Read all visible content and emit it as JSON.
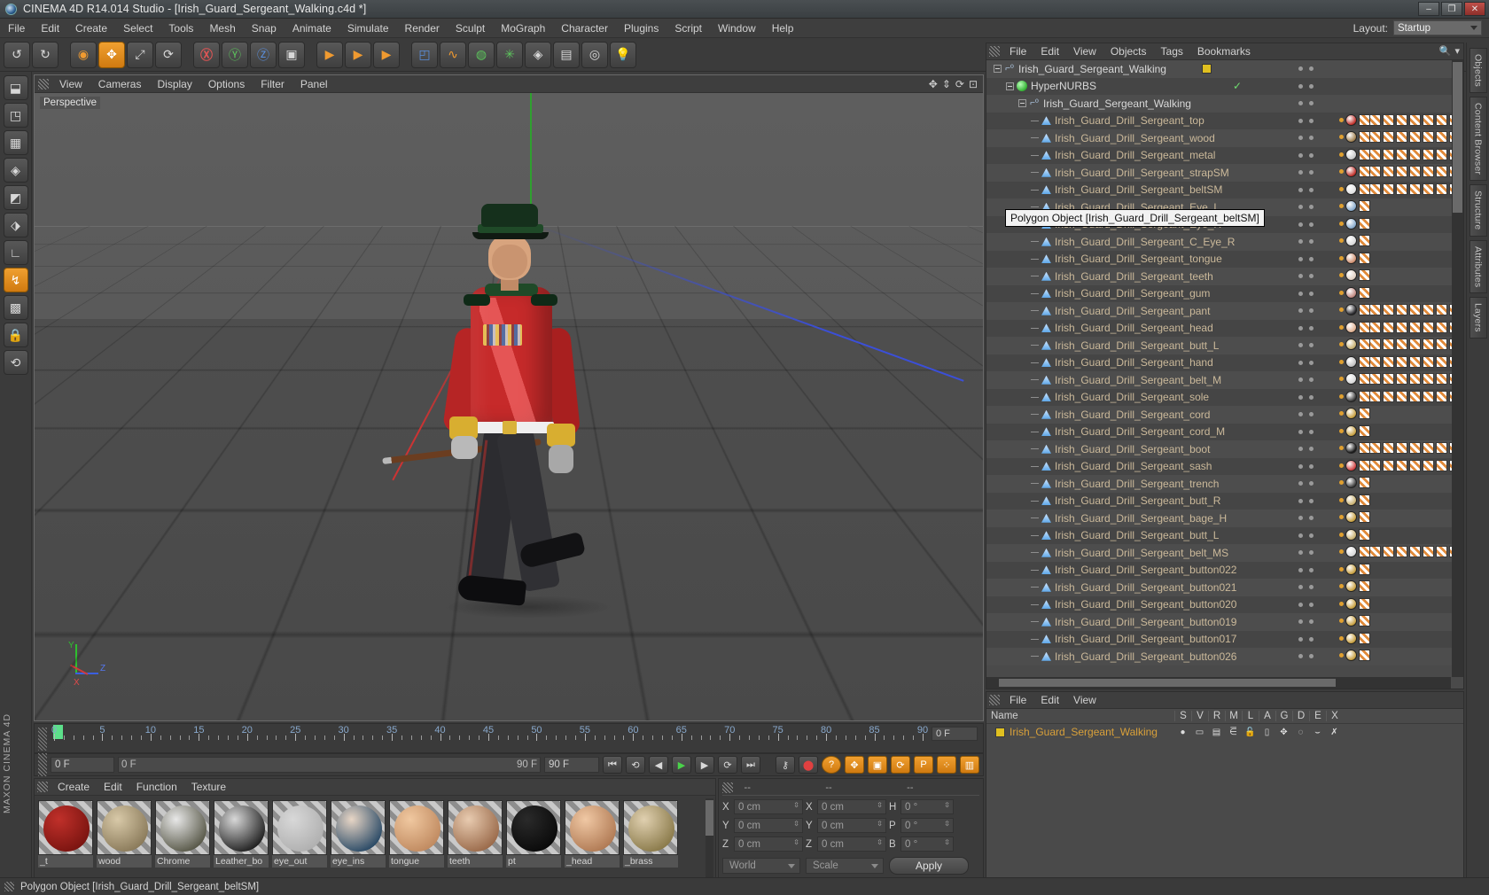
{
  "window": {
    "title": "CINEMA 4D R14.014 Studio - [Irish_Guard_Sergeant_Walking.c4d *]",
    "buttons": {
      "minimize": "–",
      "maximize": "❐",
      "close": "✕"
    }
  },
  "menubar": {
    "items": [
      "File",
      "Edit",
      "Create",
      "Select",
      "Tools",
      "Mesh",
      "Snap",
      "Animate",
      "Simulate",
      "Render",
      "Sculpt",
      "MoGraph",
      "Character",
      "Plugins",
      "Script",
      "Window",
      "Help"
    ],
    "layout_label": "Layout:",
    "layout_value": "Startup"
  },
  "toolbar": {
    "buttons": [
      {
        "name": "undo-button",
        "glyph": "↺"
      },
      {
        "name": "redo-button",
        "glyph": "↻"
      },
      {
        "name": "live-selection-button",
        "glyph": "◉"
      },
      {
        "name": "move-button",
        "glyph": "✥"
      },
      {
        "name": "scale-button",
        "glyph": "⤢"
      },
      {
        "name": "rotate-button",
        "glyph": "⟳"
      },
      {
        "name": "lock-x-axis-button",
        "glyph": "X"
      },
      {
        "name": "lock-y-axis-button",
        "glyph": "Y"
      },
      {
        "name": "lock-z-axis-button",
        "glyph": "Z"
      },
      {
        "name": "world-object-coordinates-button",
        "glyph": "▣"
      },
      {
        "name": "render-view-button",
        "glyph": "▶"
      },
      {
        "name": "render-region-button",
        "glyph": "▶"
      },
      {
        "name": "render-settings-button",
        "glyph": "▶"
      },
      {
        "name": "add-cube-button",
        "glyph": "◰"
      },
      {
        "name": "add-spline-button",
        "glyph": "∿"
      },
      {
        "name": "add-hypernurbs-button",
        "glyph": "◍"
      },
      {
        "name": "add-array-button",
        "glyph": "✳"
      },
      {
        "name": "add-scene-object-button",
        "glyph": "◈"
      },
      {
        "name": "add-camera-button",
        "glyph": "⬭"
      },
      {
        "name": "add-floor-button",
        "glyph": "▤"
      },
      {
        "name": "add-stage-button",
        "glyph": "◉◉"
      },
      {
        "name": "add-light-button",
        "glyph": "💡"
      }
    ]
  },
  "left_tools": [
    {
      "name": "make-editable-button",
      "glyph": "⬓"
    },
    {
      "name": "model-mode-button",
      "glyph": "◳"
    },
    {
      "name": "texture-mode-button",
      "glyph": "▦"
    },
    {
      "name": "points-mode-button",
      "glyph": "◈"
    },
    {
      "name": "edges-mode-button",
      "glyph": "◩"
    },
    {
      "name": "polygons-mode-button",
      "glyph": "⬗"
    },
    {
      "name": "axis-mode-button",
      "glyph": "∟"
    },
    {
      "name": "enable-axis-button",
      "glyph": "↯",
      "active": true
    },
    {
      "name": "viewport-solo-button",
      "glyph": "▩"
    },
    {
      "name": "lock-workplane-button",
      "glyph": "🔒"
    },
    {
      "name": "workplane-button",
      "glyph": "⟲"
    }
  ],
  "brand": "MAXON CINEMA 4D",
  "viewport": {
    "menu": [
      "View",
      "Cameras",
      "Display",
      "Options",
      "Filter",
      "Panel"
    ],
    "label": "Perspective",
    "axis_labels": {
      "x": "X",
      "y": "Y",
      "z": "Z"
    },
    "corner_tools": [
      "✥",
      "⇕",
      "⟳",
      "⊡"
    ]
  },
  "timeline": {
    "start_frame_marker": "0",
    "ticks": [
      0,
      5,
      10,
      15,
      20,
      25,
      30,
      35,
      40,
      45,
      50,
      55,
      60,
      65,
      70,
      75,
      80,
      85,
      90
    ],
    "end_field": "0 F"
  },
  "transport": {
    "current_frame": "0 F",
    "range_start": "0 F",
    "range_end": "90 F",
    "max_frame": "90 F",
    "buttons": [
      {
        "name": "go-to-start-button",
        "glyph": "⏮"
      },
      {
        "name": "play-reverse-loop-button",
        "glyph": "⟲"
      },
      {
        "name": "step-back-button",
        "glyph": "◀"
      },
      {
        "name": "play-button",
        "glyph": "▶"
      },
      {
        "name": "step-forward-button",
        "glyph": "▶"
      },
      {
        "name": "play-forward-loop-button",
        "glyph": "⟳"
      },
      {
        "name": "go-to-end-button",
        "glyph": "⏭"
      },
      {
        "name": "autokey-button",
        "glyph": "⚷"
      },
      {
        "name": "record-button",
        "glyph": "⬤"
      },
      {
        "name": "keyframe-help-button",
        "glyph": "?"
      },
      {
        "name": "record-position-button",
        "glyph": "✥"
      },
      {
        "name": "record-scale-button",
        "glyph": "▣"
      },
      {
        "name": "record-rotation-button",
        "glyph": "⟳"
      },
      {
        "name": "record-parameter-button",
        "glyph": "P"
      },
      {
        "name": "record-pla-button",
        "glyph": "⁖"
      },
      {
        "name": "keyframe-selection-button",
        "glyph": "▥"
      }
    ]
  },
  "material_manager": {
    "menu": [
      "Create",
      "Edit",
      "Function",
      "Texture"
    ],
    "materials": [
      {
        "name": "_t",
        "color1": "#c0302a",
        "color2": "#7a1410"
      },
      {
        "name": "wood",
        "color1": "#d8c9a8",
        "color2": "#8a7a5a"
      },
      {
        "name": "Chrome",
        "color1": "#e8e8e8",
        "color2": "#585848"
      },
      {
        "name": "Leather_bo",
        "color1": "#d8d8d8",
        "color2": "#202020"
      },
      {
        "name": "eye_out",
        "color1": "#d8d8d8",
        "color2": "#b0b0b0"
      },
      {
        "name": "eye_ins",
        "color1": "#e8d6c6",
        "color2": "#2a4a66"
      },
      {
        "name": "tongue",
        "color1": "#f0c8a0",
        "color2": "#c08a60"
      },
      {
        "name": "teeth",
        "color1": "#e8cbb0",
        "color2": "#9a6a4a"
      },
      {
        "name": "pt",
        "color1": "#2a2a2a",
        "color2": "#0a0a0a"
      },
      {
        "name": "_head",
        "color1": "#f0c8a4",
        "color2": "#b07a54"
      },
      {
        "name": "_brass",
        "color1": "#e0d0b0",
        "color2": "#8a7a4a"
      }
    ]
  },
  "coordinates": {
    "header": [
      "--",
      "--",
      "--"
    ],
    "rows": [
      {
        "pos_label": "X",
        "pos_value": "0 cm",
        "size_label": "X",
        "size_value": "0 cm",
        "rot_label": "H",
        "rot_value": "0 °"
      },
      {
        "pos_label": "Y",
        "pos_value": "0 cm",
        "size_label": "Y",
        "size_value": "0 cm",
        "rot_label": "P",
        "rot_value": "0 °"
      },
      {
        "pos_label": "Z",
        "pos_value": "0 cm",
        "size_label": "Z",
        "size_value": "0 cm",
        "rot_label": "B",
        "rot_value": "0 °"
      }
    ],
    "system": "World",
    "mode": "Scale",
    "apply": "Apply"
  },
  "object_manager": {
    "menu": [
      "File",
      "Edit",
      "View",
      "Objects",
      "Tags",
      "Bookmarks"
    ],
    "tooltip": "Polygon Object [Irish_Guard_Drill_Sergeant_beltSM]",
    "items": [
      {
        "label": "Irish_Guard_Sergeant_Walking",
        "indent": 0,
        "icon": "null-icon",
        "type": "null",
        "expander": true,
        "color": "white",
        "swatch": "#e0c020",
        "check": false
      },
      {
        "label": "HyperNURBS",
        "indent": 1,
        "icon": "hypernurbs-icon",
        "type": "hypernurbs",
        "expander": true,
        "color": "white",
        "check": true
      },
      {
        "label": "Irish_Guard_Sergeant_Walking",
        "indent": 2,
        "icon": "null-icon",
        "type": "null",
        "expander": true,
        "color": "white"
      },
      {
        "label": "Irish_Guard_Drill_Sergeant_top",
        "indent": 3,
        "icon": "polygon-icon",
        "type": "poly",
        "mat": "#c0302a",
        "tex": true
      },
      {
        "label": "Irish_Guard_Drill_Sergeant_wood",
        "indent": 3,
        "icon": "polygon-icon",
        "type": "poly",
        "mat": "#a08050",
        "tex": true
      },
      {
        "label": "Irish_Guard_Drill_Sergeant_metal",
        "indent": 3,
        "icon": "polygon-icon",
        "type": "poly",
        "mat": "#c8c8c8",
        "tex": true
      },
      {
        "label": "Irish_Guard_Drill_Sergeant_strapSM",
        "indent": 3,
        "icon": "polygon-icon",
        "type": "poly",
        "mat": "#c0302a",
        "tex": true
      },
      {
        "label": "Irish_Guard_Drill_Sergeant_beltSM",
        "indent": 3,
        "icon": "polygon-icon",
        "type": "poly",
        "mat": "#e0e0e0",
        "tex": true
      },
      {
        "label": "Irish_Guard_Drill_Sergeant_Eye_L",
        "indent": 3,
        "icon": "polygon-icon",
        "type": "poly",
        "mat": "#88aacc",
        "tex": false
      },
      {
        "label": "Irish_Guard_Drill_Sergeant_Eye_R",
        "indent": 3,
        "icon": "polygon-icon",
        "type": "poly",
        "mat": "#88aacc",
        "tex": false
      },
      {
        "label": "Irish_Guard_Drill_Sergeant_C_Eye_R",
        "indent": 3,
        "icon": "polygon-icon",
        "type": "poly",
        "mat": "#d8d8d8",
        "tex": false
      },
      {
        "label": "Irish_Guard_Drill_Sergeant_tongue",
        "indent": 3,
        "icon": "polygon-icon",
        "type": "poly",
        "mat": "#d09070",
        "tex": false
      },
      {
        "label": "Irish_Guard_Drill_Sergeant_teeth",
        "indent": 3,
        "icon": "polygon-icon",
        "type": "poly",
        "mat": "#e0cfc0",
        "tex": false
      },
      {
        "label": "Irish_Guard_Drill_Sergeant_gum",
        "indent": 3,
        "icon": "polygon-icon",
        "type": "poly",
        "mat": "#c08880",
        "tex": false
      },
      {
        "label": "Irish_Guard_Drill_Sergeant_pant",
        "indent": 3,
        "icon": "polygon-icon",
        "type": "poly",
        "mat": "#2a2a2e",
        "tex": true
      },
      {
        "label": "Irish_Guard_Drill_Sergeant_head",
        "indent": 3,
        "icon": "polygon-icon",
        "type": "poly",
        "mat": "#e0b090",
        "tex": true
      },
      {
        "label": "Irish_Guard_Drill_Sergeant_butt_L",
        "indent": 3,
        "icon": "polygon-icon",
        "type": "poly",
        "mat": "#c8b070",
        "tex": true
      },
      {
        "label": "Irish_Guard_Drill_Sergeant_hand",
        "indent": 3,
        "icon": "polygon-icon",
        "type": "poly",
        "mat": "#c0c0c0",
        "tex": true
      },
      {
        "label": "Irish_Guard_Drill_Sergeant_belt_M",
        "indent": 3,
        "icon": "polygon-icon",
        "type": "poly",
        "mat": "#d8d8d8",
        "tex": true
      },
      {
        "label": "Irish_Guard_Drill_Sergeant_sole",
        "indent": 3,
        "icon": "polygon-icon",
        "type": "poly",
        "mat": "#3a3a3a",
        "tex": true
      },
      {
        "label": "Irish_Guard_Drill_Sergeant_cord",
        "indent": 3,
        "icon": "polygon-icon",
        "type": "poly",
        "mat": "#c8a040",
        "tex": false
      },
      {
        "label": "Irish_Guard_Drill_Sergeant_cord_M",
        "indent": 3,
        "icon": "polygon-icon",
        "type": "poly",
        "mat": "#c8a040",
        "tex": false
      },
      {
        "label": "Irish_Guard_Drill_Sergeant_boot",
        "indent": 3,
        "icon": "polygon-icon",
        "type": "poly",
        "mat": "#1a1a1a",
        "tex": true
      },
      {
        "label": "Irish_Guard_Drill_Sergeant_sash",
        "indent": 3,
        "icon": "polygon-icon",
        "type": "poly",
        "mat": "#d04040",
        "tex": true
      },
      {
        "label": "Irish_Guard_Drill_Sergeant_trench",
        "indent": 3,
        "icon": "polygon-icon",
        "type": "poly",
        "mat": "#404040",
        "tex": false
      },
      {
        "label": "Irish_Guard_Drill_Sergeant_butt_R",
        "indent": 3,
        "icon": "polygon-icon",
        "type": "poly",
        "mat": "#c8b070",
        "tex": false
      },
      {
        "label": "Irish_Guard_Drill_Sergeant_bage_H",
        "indent": 3,
        "icon": "polygon-icon",
        "type": "poly",
        "mat": "#c8a040",
        "tex": false
      },
      {
        "label": "Irish_Guard_Drill_Sergeant_butt_L",
        "indent": 3,
        "icon": "polygon-icon",
        "type": "poly",
        "mat": "#c8b070",
        "tex": false
      },
      {
        "label": "Irish_Guard_Drill_Sergeant_belt_MS",
        "indent": 3,
        "icon": "polygon-icon",
        "type": "poly",
        "mat": "#d8d8d8",
        "tex": true
      },
      {
        "label": "Irish_Guard_Drill_Sergeant_button022",
        "indent": 3,
        "icon": "polygon-icon",
        "type": "poly",
        "mat": "#c8a040",
        "tex": false
      },
      {
        "label": "Irish_Guard_Drill_Sergeant_button021",
        "indent": 3,
        "icon": "polygon-icon",
        "type": "poly",
        "mat": "#c8a040",
        "tex": false
      },
      {
        "label": "Irish_Guard_Drill_Sergeant_button020",
        "indent": 3,
        "icon": "polygon-icon",
        "type": "poly",
        "mat": "#c8a040",
        "tex": false
      },
      {
        "label": "Irish_Guard_Drill_Sergeant_button019",
        "indent": 3,
        "icon": "polygon-icon",
        "type": "poly",
        "mat": "#c8a040",
        "tex": false
      },
      {
        "label": "Irish_Guard_Drill_Sergeant_button017",
        "indent": 3,
        "icon": "polygon-icon",
        "type": "poly",
        "mat": "#c8a040",
        "tex": false
      },
      {
        "label": "Irish_Guard_Drill_Sergeant_button026",
        "indent": 3,
        "icon": "polygon-icon",
        "type": "poly",
        "mat": "#c8a040",
        "tex": false
      }
    ]
  },
  "attribute_manager": {
    "menu": [
      "File",
      "Edit",
      "View"
    ],
    "columns": [
      "Name",
      "S",
      "V",
      "R",
      "M",
      "L",
      "A",
      "G",
      "D",
      "E",
      "X"
    ],
    "row": {
      "label": "Irish_Guard_Sergeant_Walking",
      "cells": [
        "●",
        "▭",
        "▤",
        "⋶",
        "🔓",
        "▯",
        "✥",
        "◌",
        "⌣",
        "✗"
      ]
    }
  },
  "right_tabs": [
    "Objects",
    "Content Browser",
    "Structure",
    "Attributes",
    "Layers"
  ],
  "status_bar": {
    "text": "Polygon Object [Irish_Guard_Drill_Sergeant_beltSM]"
  }
}
